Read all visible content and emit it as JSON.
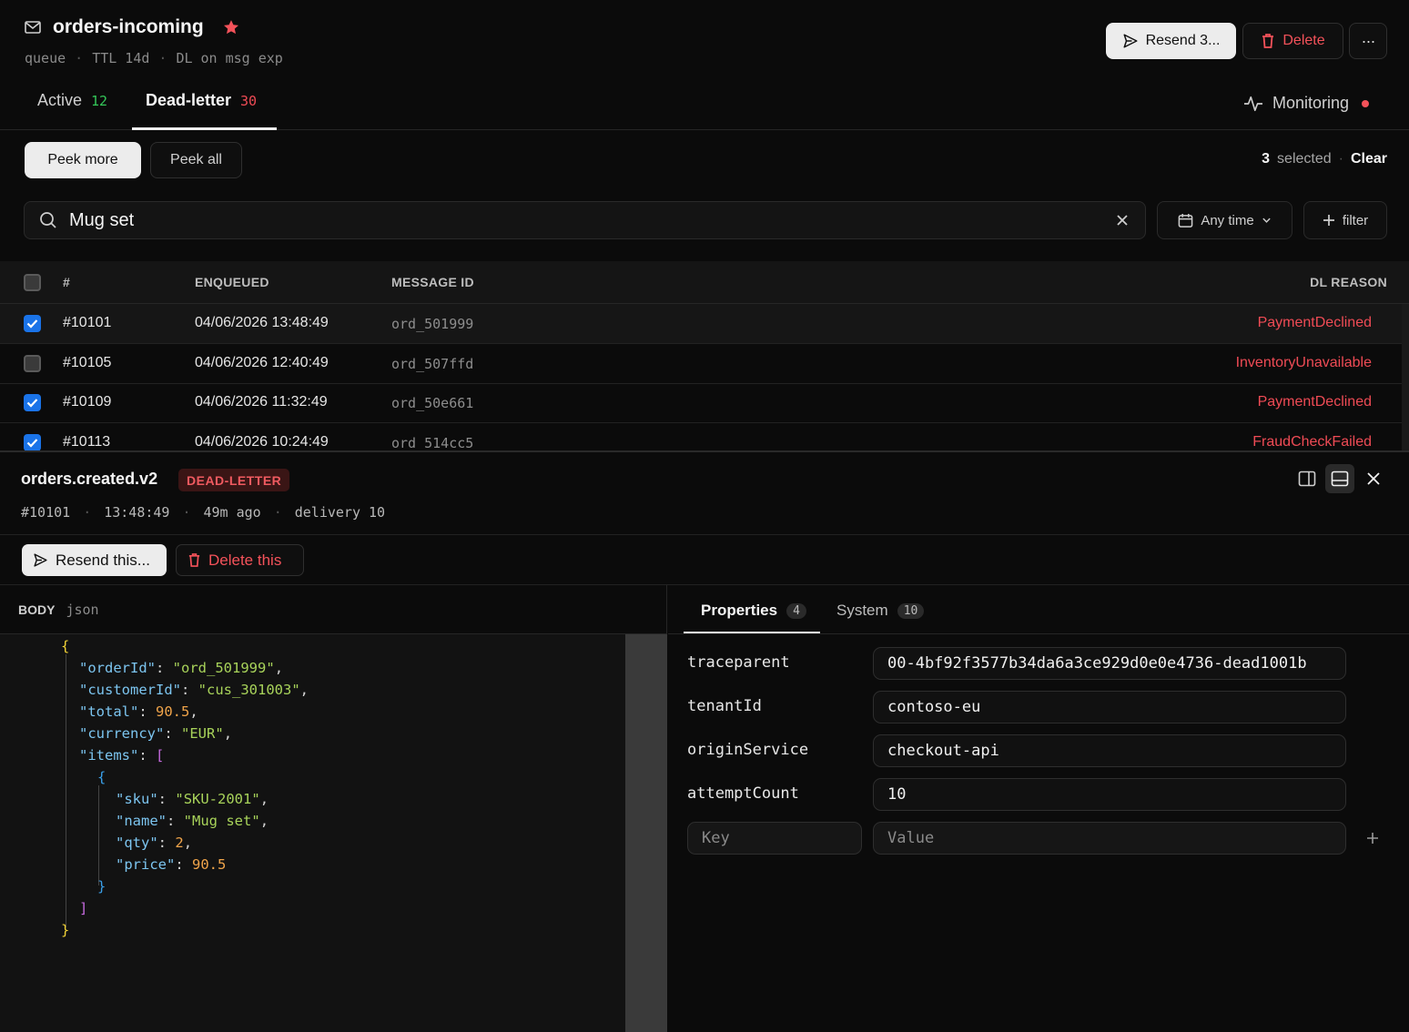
{
  "header": {
    "title": "orders-incoming",
    "subtitle": [
      "queue",
      "TTL 14d",
      "DL on msg exp"
    ],
    "resend_label": "Resend 3...",
    "delete_label": "Delete",
    "more_label": "···"
  },
  "tabs": [
    {
      "label": "Active",
      "count": "12"
    },
    {
      "label": "Dead-letter",
      "count": "30"
    }
  ],
  "monitoring_label": "Monitoring",
  "toolbar": {
    "peek_more": "Peek more",
    "peek_all": "Peek all",
    "selected_count": "3",
    "selected_label": "selected",
    "clear_label": "Clear"
  },
  "search": {
    "value": "Mug set",
    "time_filter": "Any time",
    "add_filter": "filter"
  },
  "table": {
    "columns": [
      "#",
      "ENQUEUED",
      "MESSAGE ID",
      "DL REASON"
    ],
    "rows": [
      {
        "seq": "#10101",
        "enqueued": "04/06/2026 13:48:49",
        "message_id": "ord_501999",
        "reason": "PaymentDeclined",
        "checked": true
      },
      {
        "seq": "#10105",
        "enqueued": "04/06/2026 12:40:49",
        "message_id": "ord_507ffd",
        "reason": "InventoryUnavailable",
        "checked": false
      },
      {
        "seq": "#10109",
        "enqueued": "04/06/2026 11:32:49",
        "message_id": "ord_50e661",
        "reason": "PaymentDeclined",
        "checked": true
      },
      {
        "seq": "#10113",
        "enqueued": "04/06/2026 10:24:49",
        "message_id": "ord_514cc5",
        "reason": "FraudCheckFailed",
        "checked": true
      }
    ]
  },
  "detail": {
    "title": "orders.created.v2",
    "badge": "DEAD-LETTER",
    "meta": [
      "#10101",
      "13:48:49",
      "49m ago",
      "delivery 10"
    ],
    "resend_label": "Resend this...",
    "delete_label": "Delete this",
    "body_label": "BODY",
    "body_format": "json",
    "body": {
      "orderId": "ord_501999",
      "customerId": "cus_301003",
      "total": "90.5",
      "currency": "EUR",
      "item_sku": "SKU-2001",
      "item_name": "Mug set",
      "item_qty": "2",
      "item_price": "90.5"
    },
    "props_tabs": [
      {
        "label": "Properties",
        "count": "4"
      },
      {
        "label": "System",
        "count": "10"
      }
    ],
    "properties": [
      {
        "key": "traceparent",
        "value": "00-4bf92f3577b34da6a3ce929d0e0e4736-dead1001b"
      },
      {
        "key": "tenantId",
        "value": "contoso-eu"
      },
      {
        "key": "originService",
        "value": "checkout-api"
      },
      {
        "key": "attemptCount",
        "value": "10"
      }
    ],
    "key_placeholder": "Key",
    "value_placeholder": "Value"
  },
  "colors": {
    "accent_red": "#ef4b55",
    "checkbox_blue": "#1a73e8",
    "active_count_green": "#34c759"
  }
}
